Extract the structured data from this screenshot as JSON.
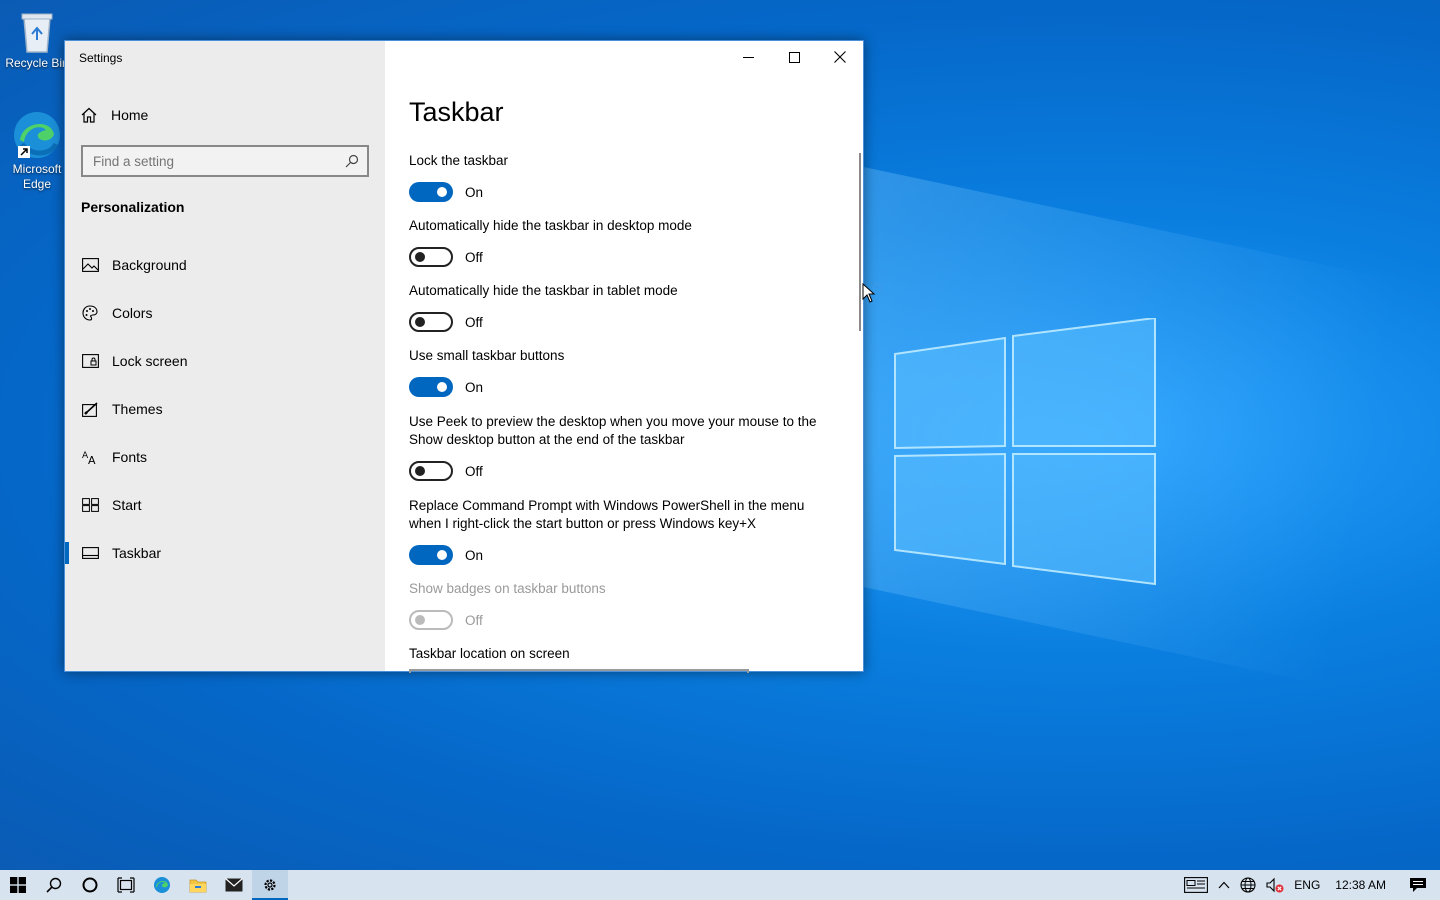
{
  "desktop": {
    "icons": [
      {
        "label": "Recycle Bin",
        "icon": "recycle-bin-icon"
      },
      {
        "label": "Microsoft Edge",
        "icon": "edge-icon"
      }
    ]
  },
  "window": {
    "title": "Settings",
    "controls": [
      "minimize-icon",
      "maximize-icon",
      "close-icon"
    ]
  },
  "sidebar": {
    "home": "Home",
    "search_placeholder": "Find a setting",
    "section": "Personalization",
    "items": [
      {
        "label": "Background",
        "icon": "picture-icon"
      },
      {
        "label": "Colors",
        "icon": "palette-icon"
      },
      {
        "label": "Lock screen",
        "icon": "lock-screen-icon"
      },
      {
        "label": "Themes",
        "icon": "brush-icon"
      },
      {
        "label": "Fonts",
        "icon": "fonts-icon"
      },
      {
        "label": "Start",
        "icon": "start-grid-icon"
      },
      {
        "label": "Taskbar",
        "icon": "taskbar-icon",
        "active": true
      }
    ]
  },
  "main": {
    "title": "Taskbar",
    "settings": [
      {
        "label": "Lock the taskbar",
        "state": "On"
      },
      {
        "label": "Automatically hide the taskbar in desktop mode",
        "state": "Off"
      },
      {
        "label": "Automatically hide the taskbar in tablet mode",
        "state": "Off"
      },
      {
        "label": "Use small taskbar buttons",
        "state": "On"
      },
      {
        "label": "Use Peek to preview the desktop when you move your mouse to the Show desktop button at the end of the taskbar",
        "state": "Off"
      },
      {
        "label": "Replace Command Prompt with Windows PowerShell in the menu when I right-click the start button or press Windows key+X",
        "state": "On"
      },
      {
        "label": "Show badges on taskbar buttons",
        "state": "Off",
        "disabled": true
      }
    ],
    "location_label": "Taskbar location on screen"
  },
  "taskbar": {
    "buttons": [
      "start-icon",
      "search-icon",
      "cortana-icon",
      "task-view-icon",
      "edge-icon",
      "file-explorer-icon",
      "mail-icon",
      "settings-gear-icon"
    ],
    "tray": {
      "language": "ENG",
      "time": "12:38 AM"
    }
  },
  "colors": {
    "accent": "#0067c0",
    "sidebar_bg": "#ececec",
    "taskbar_bg": "#d7e4f0"
  }
}
